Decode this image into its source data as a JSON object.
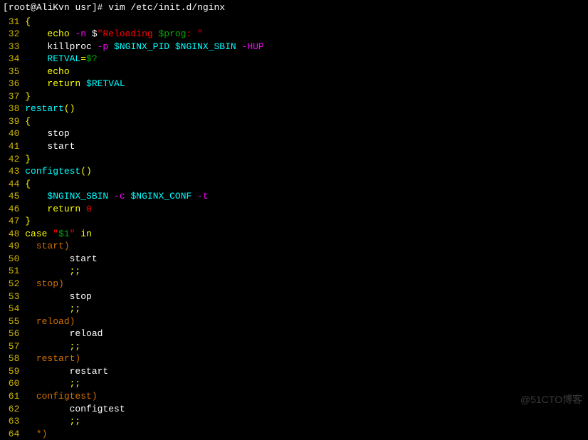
{
  "prompt": {
    "user": "root",
    "host": "AliKvn",
    "cwd": "usr",
    "command": "vim",
    "arg": "/etc/init.d/nginx"
  },
  "lines": [
    {
      "n": 31,
      "segs": [
        {
          "t": " ",
          "c": "plain"
        },
        {
          "t": "{",
          "c": "brace"
        }
      ]
    },
    {
      "n": 32,
      "segs": [
        {
          "t": "     ",
          "c": "plain"
        },
        {
          "t": "echo",
          "c": "kw"
        },
        {
          "t": " ",
          "c": "plain"
        },
        {
          "t": "-n",
          "c": "opt"
        },
        {
          "t": " $",
          "c": "plain"
        },
        {
          "t": "\"Reloading ",
          "c": "str"
        },
        {
          "t": "$prog",
          "c": "var2"
        },
        {
          "t": ": \"",
          "c": "str"
        }
      ]
    },
    {
      "n": 33,
      "segs": [
        {
          "t": "     killproc ",
          "c": "plain"
        },
        {
          "t": "-p",
          "c": "opt"
        },
        {
          "t": " ",
          "c": "plain"
        },
        {
          "t": "$NGINX_PID",
          "c": "var"
        },
        {
          "t": " ",
          "c": "plain"
        },
        {
          "t": "$NGINX_SBIN",
          "c": "var"
        },
        {
          "t": " ",
          "c": "plain"
        },
        {
          "t": "-HUP",
          "c": "opt"
        }
      ]
    },
    {
      "n": 34,
      "segs": [
        {
          "t": "     ",
          "c": "plain"
        },
        {
          "t": "RETVAL",
          "c": "var"
        },
        {
          "t": "=",
          "c": "assign"
        },
        {
          "t": "$?",
          "c": "var2"
        }
      ]
    },
    {
      "n": 35,
      "segs": [
        {
          "t": "     ",
          "c": "plain"
        },
        {
          "t": "echo",
          "c": "kw"
        }
      ]
    },
    {
      "n": 36,
      "segs": [
        {
          "t": "     ",
          "c": "plain"
        },
        {
          "t": "return",
          "c": "kw"
        },
        {
          "t": " ",
          "c": "plain"
        },
        {
          "t": "$RETVAL",
          "c": "var"
        }
      ]
    },
    {
      "n": 37,
      "segs": [
        {
          "t": " ",
          "c": "plain"
        },
        {
          "t": "}",
          "c": "brace"
        }
      ]
    },
    {
      "n": 38,
      "segs": [
        {
          "t": " ",
          "c": "plain"
        },
        {
          "t": "restart",
          "c": "func"
        },
        {
          "t": "()",
          "c": "op"
        }
      ]
    },
    {
      "n": 39,
      "segs": [
        {
          "t": " ",
          "c": "plain"
        },
        {
          "t": "{",
          "c": "brace"
        }
      ]
    },
    {
      "n": 40,
      "segs": [
        {
          "t": "     stop",
          "c": "plain"
        }
      ]
    },
    {
      "n": 41,
      "segs": [
        {
          "t": "     start",
          "c": "plain"
        }
      ]
    },
    {
      "n": 42,
      "segs": [
        {
          "t": " ",
          "c": "plain"
        },
        {
          "t": "}",
          "c": "brace"
        }
      ]
    },
    {
      "n": 43,
      "segs": [
        {
          "t": " ",
          "c": "plain"
        },
        {
          "t": "configtest",
          "c": "func"
        },
        {
          "t": "()",
          "c": "op"
        }
      ]
    },
    {
      "n": 44,
      "segs": [
        {
          "t": " ",
          "c": "plain"
        },
        {
          "t": "{",
          "c": "brace"
        }
      ]
    },
    {
      "n": 45,
      "segs": [
        {
          "t": "     ",
          "c": "plain"
        },
        {
          "t": "$NGINX_SBIN",
          "c": "var"
        },
        {
          "t": " ",
          "c": "plain"
        },
        {
          "t": "-c",
          "c": "opt"
        },
        {
          "t": " ",
          "c": "plain"
        },
        {
          "t": "$NGINX_CONF",
          "c": "var"
        },
        {
          "t": " ",
          "c": "plain"
        },
        {
          "t": "-t",
          "c": "opt"
        }
      ]
    },
    {
      "n": 46,
      "segs": [
        {
          "t": "     ",
          "c": "plain"
        },
        {
          "t": "return",
          "c": "kw"
        },
        {
          "t": " ",
          "c": "plain"
        },
        {
          "t": "0",
          "c": "str"
        }
      ]
    },
    {
      "n": 47,
      "segs": [
        {
          "t": " ",
          "c": "plain"
        },
        {
          "t": "}",
          "c": "brace"
        }
      ]
    },
    {
      "n": 48,
      "segs": [
        {
          "t": " ",
          "c": "plain"
        },
        {
          "t": "case",
          "c": "case-start"
        },
        {
          "t": " ",
          "c": "plain"
        },
        {
          "t": "\"",
          "c": "str"
        },
        {
          "t": "$1",
          "c": "var2"
        },
        {
          "t": "\"",
          "c": "str"
        },
        {
          "t": " ",
          "c": "plain"
        },
        {
          "t": "in",
          "c": "case-start"
        }
      ]
    },
    {
      "n": 49,
      "segs": [
        {
          "t": "   ",
          "c": "plain"
        },
        {
          "t": "start)",
          "c": "case-label"
        }
      ]
    },
    {
      "n": 50,
      "segs": [
        {
          "t": "         start",
          "c": "plain"
        }
      ]
    },
    {
      "n": 51,
      "segs": [
        {
          "t": "         ",
          "c": "plain"
        },
        {
          "t": ";;",
          "c": "semi"
        }
      ]
    },
    {
      "n": 52,
      "segs": [
        {
          "t": "   ",
          "c": "plain"
        },
        {
          "t": "stop)",
          "c": "case-label"
        }
      ]
    },
    {
      "n": 53,
      "segs": [
        {
          "t": "         stop",
          "c": "plain"
        }
      ]
    },
    {
      "n": 54,
      "segs": [
        {
          "t": "         ",
          "c": "plain"
        },
        {
          "t": ";;",
          "c": "semi"
        }
      ]
    },
    {
      "n": 55,
      "segs": [
        {
          "t": "   ",
          "c": "plain"
        },
        {
          "t": "reload)",
          "c": "case-label"
        }
      ]
    },
    {
      "n": 56,
      "segs": [
        {
          "t": "         reload",
          "c": "plain"
        }
      ]
    },
    {
      "n": 57,
      "segs": [
        {
          "t": "         ",
          "c": "plain"
        },
        {
          "t": ";;",
          "c": "semi"
        }
      ]
    },
    {
      "n": 58,
      "segs": [
        {
          "t": "   ",
          "c": "plain"
        },
        {
          "t": "restart)",
          "c": "case-label"
        }
      ]
    },
    {
      "n": 59,
      "segs": [
        {
          "t": "         restart",
          "c": "plain"
        }
      ]
    },
    {
      "n": 60,
      "segs": [
        {
          "t": "         ",
          "c": "plain"
        },
        {
          "t": ";;",
          "c": "semi"
        }
      ]
    },
    {
      "n": 61,
      "segs": [
        {
          "t": "   ",
          "c": "plain"
        },
        {
          "t": "configtest)",
          "c": "case-label"
        }
      ]
    },
    {
      "n": 62,
      "segs": [
        {
          "t": "         configtest",
          "c": "plain"
        }
      ]
    },
    {
      "n": 63,
      "segs": [
        {
          "t": "         ",
          "c": "plain"
        },
        {
          "t": ";;",
          "c": "semi"
        }
      ]
    },
    {
      "n": 64,
      "segs": [
        {
          "t": "   ",
          "c": "plain"
        },
        {
          "t": "*)",
          "c": "case-label"
        }
      ]
    }
  ],
  "watermark": "@51CTO博客"
}
